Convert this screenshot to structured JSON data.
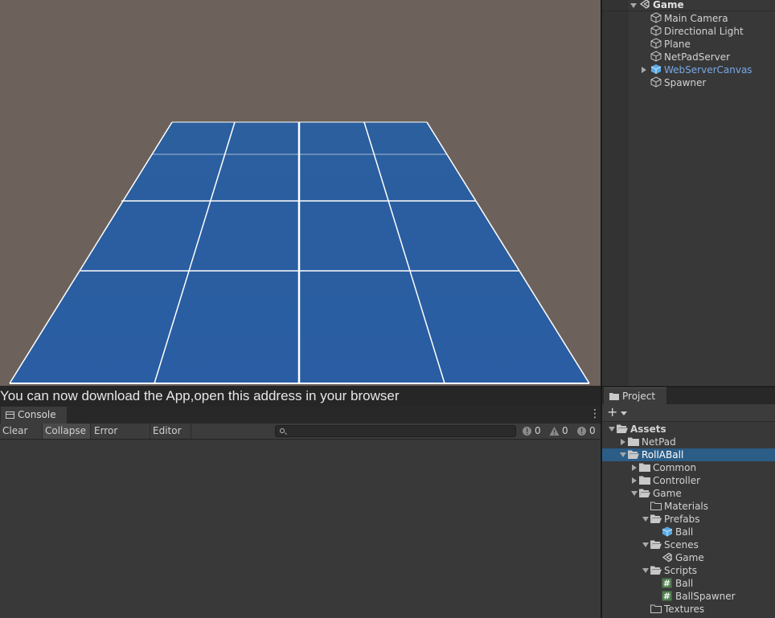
{
  "scene": {
    "background": "#6d625b",
    "plane_color": "#2a5ea0",
    "grid_line_color": "#ffffff"
  },
  "status": {
    "message": "You can now download the App,open this address in your browser"
  },
  "hierarchy": {
    "root": "Game",
    "items": [
      {
        "label": "Main Camera",
        "icon": "cube-outline-icon"
      },
      {
        "label": "Directional Light",
        "icon": "cube-outline-icon"
      },
      {
        "label": "Plane",
        "icon": "cube-outline-icon"
      },
      {
        "label": "NetPadServer",
        "icon": "cube-outline-icon"
      },
      {
        "label": "WebServerCanvas",
        "icon": "prefab-cube-icon",
        "expandable": true,
        "color": "#7aa8e6"
      },
      {
        "label": "Spawner",
        "icon": "cube-outline-icon"
      }
    ]
  },
  "project": {
    "tab_label": "Project",
    "add_label": "+",
    "tree": [
      {
        "label": "Assets",
        "kind": "folder-open",
        "arrow": "down",
        "bold": true
      },
      {
        "label": "NetPad",
        "kind": "folder",
        "arrow": "right"
      },
      {
        "label": "RollABall",
        "kind": "folder-open",
        "arrow": "down",
        "selected": true
      },
      {
        "label": "Common",
        "kind": "folder",
        "arrow": "right"
      },
      {
        "label": "Controller",
        "kind": "folder",
        "arrow": "right"
      },
      {
        "label": "Game",
        "kind": "folder-open",
        "arrow": "down"
      },
      {
        "label": "Materials",
        "kind": "folder-empty",
        "arrow": "none"
      },
      {
        "label": "Prefabs",
        "kind": "folder-open",
        "arrow": "down"
      },
      {
        "label": "Ball",
        "kind": "prefab",
        "arrow": "none"
      },
      {
        "label": "Scenes",
        "kind": "folder-open",
        "arrow": "down"
      },
      {
        "label": "Game",
        "kind": "scene",
        "arrow": "none"
      },
      {
        "label": "Scripts",
        "kind": "folder-open",
        "arrow": "down"
      },
      {
        "label": "Ball",
        "kind": "script",
        "arrow": "none"
      },
      {
        "label": "BallSpawner",
        "kind": "script",
        "arrow": "none"
      },
      {
        "label": "Textures",
        "kind": "folder-empty",
        "arrow": "none"
      }
    ]
  },
  "console": {
    "tab_label": "Console",
    "menu_glyph": "⋮",
    "toolbar": {
      "clear": "Clear",
      "collapse": "Collapse",
      "error_pause": "Error Pause",
      "editor": "Editor"
    },
    "search_placeholder": "",
    "counts": {
      "info": "0",
      "warning": "0",
      "error": "0"
    }
  }
}
